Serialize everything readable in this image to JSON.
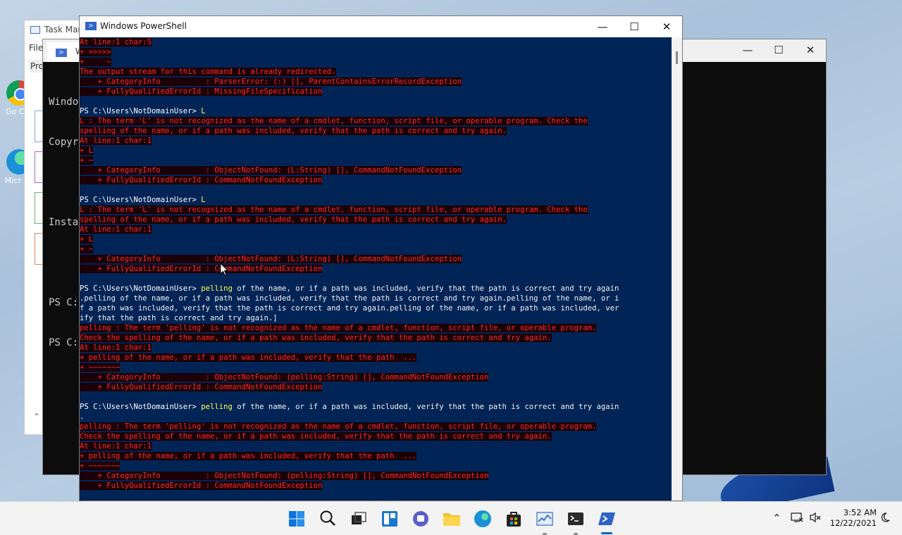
{
  "desktop": {
    "icons": [
      {
        "label": "Go Chr",
        "icon": "chrome-icon"
      },
      {
        "label": "Micr Ed",
        "icon": "edge-icon"
      }
    ]
  },
  "task_manager": {
    "title": "Task Man",
    "file_menu": "File",
    "tab": "Pro"
  },
  "terminal": {
    "tab_label": "W",
    "lines": [
      "Windo",
      "Copyr",
      "",
      "Insta",
      "",
      "PS C:",
      "PS C:"
    ]
  },
  "powershell": {
    "title": "Windows PowerShell",
    "lines": [
      {
        "type": "err",
        "text": "At line:1 char:5"
      },
      {
        "type": "err",
        "text": "+ >>>>>"
      },
      {
        "type": "err",
        "text": "+     ~"
      },
      {
        "type": "err",
        "text": "The output stream for this command is already redirected."
      },
      {
        "type": "err",
        "text": "    + CategoryInfo          : ParserError: (:) [], ParentContainsErrorRecordException"
      },
      {
        "type": "err",
        "text": "    + FullyQualifiedErrorId : MissingFileSpecification"
      },
      {
        "type": "blank",
        "text": ""
      },
      {
        "type": "cmd",
        "prompt": "PS C:\\Users\\NotDomainUser> ",
        "kw": "L",
        "arg": ""
      },
      {
        "type": "err",
        "text": "L : The term 'L' is not recognized as the name of a cmdlet, function, script file, or operable program. Check the"
      },
      {
        "type": "err",
        "text": "spelling of the name, or if a path was included, verify that the path is correct and try again."
      },
      {
        "type": "err",
        "text": "At line:1 char:1"
      },
      {
        "type": "err",
        "text": "+ L"
      },
      {
        "type": "err",
        "text": "+ ~"
      },
      {
        "type": "err",
        "text": "    + CategoryInfo          : ObjectNotFound: (L:String) [], CommandNotFoundException"
      },
      {
        "type": "err",
        "text": "    + FullyQualifiedErrorId : CommandNotFoundException"
      },
      {
        "type": "blank",
        "text": ""
      },
      {
        "type": "cmd",
        "prompt": "PS C:\\Users\\NotDomainUser> ",
        "kw": "L",
        "arg": ""
      },
      {
        "type": "err",
        "text": "L : The term 'L' is not recognized as the name of a cmdlet, function, script file, or operable program. Check the"
      },
      {
        "type": "err",
        "text": "spelling of the name, or if a path was included, verify that the path is correct and try again."
      },
      {
        "type": "err",
        "text": "At line:1 char:1"
      },
      {
        "type": "err",
        "text": "+ L"
      },
      {
        "type": "err",
        "text": "+ ~"
      },
      {
        "type": "err",
        "text": "    + CategoryInfo          : ObjectNotFound: (L:String) [], CommandNotFoundException"
      },
      {
        "type": "err",
        "text": "    + FullyQualifiedErrorId : CommandNotFoundException"
      },
      {
        "type": "blank",
        "text": ""
      },
      {
        "type": "cmd",
        "prompt": "PS C:\\Users\\NotDomainUser> ",
        "kw": "pelling",
        "arg": " of the name, or if a path was included, verify that the path is correct and try again"
      },
      {
        "type": "plain",
        "text": ".pelling of the name, or if a path was included, verify that the path is correct and try again.pelling of the name, or i"
      },
      {
        "type": "plain",
        "text": "f a path was included, verify that the path is correct and try again.pelling of the name, or if a path was included, ver"
      },
      {
        "type": "plain",
        "text": "ify that the path is correct and try again.]"
      },
      {
        "type": "err",
        "text": "pelling : The term 'pelling' is not recognized as the name of a cmdlet, function, script file, or operable program."
      },
      {
        "type": "err",
        "text": "Check the spelling of the name, or if a path was included, verify that the path is correct and try again."
      },
      {
        "type": "err",
        "text": "At line:1 char:1"
      },
      {
        "type": "err",
        "text": "+ pelling of the name, or if a path was included, verify that the path  ..."
      },
      {
        "type": "err",
        "text": "+ ~~~~~~~"
      },
      {
        "type": "err",
        "text": "    + CategoryInfo          : ObjectNotFound: (pelling:String) [], CommandNotFoundException"
      },
      {
        "type": "err",
        "text": "    + FullyQualifiedErrorId : CommandNotFoundException"
      },
      {
        "type": "blank",
        "text": ""
      },
      {
        "type": "cmd",
        "prompt": "PS C:\\Users\\NotDomainUser> ",
        "kw": "pelling",
        "arg": " of the name, or if a path was included, verify that the path is correct and try again"
      },
      {
        "type": "plain",
        "text": "."
      },
      {
        "type": "err",
        "text": "pelling : The term 'pelling' is not recognized as the name of a cmdlet, function, script file, or operable program."
      },
      {
        "type": "err",
        "text": "Check the spelling of the name, or if a path was included, verify that the path is correct and try again."
      },
      {
        "type": "err",
        "text": "At line:1 char:1"
      },
      {
        "type": "err",
        "text": "+ pelling of the name, or if a path was included, verify that the path  ..."
      },
      {
        "type": "err",
        "text": "+ ~~~~~~~"
      },
      {
        "type": "err",
        "text": "    + CategoryInfo          : ObjectNotFound: (pelling:String) [], CommandNotFoundException"
      },
      {
        "type": "err",
        "text": "    + FullyQualifiedErrorId : CommandNotFoundException"
      },
      {
        "type": "blank",
        "text": ""
      }
    ]
  },
  "taskbar": {
    "apps": [
      "start-icon",
      "search-icon",
      "task-view-icon",
      "widgets-icon",
      "chat-icon",
      "file-explorer-icon",
      "edge-icon",
      "store-icon",
      "task-manager-icon",
      "terminal-icon",
      "powershell-icon"
    ],
    "time": "3:52 AM",
    "date": "12/22/2021"
  },
  "colors": {
    "ps_background": "#012456",
    "error_text": "#ff2a2a",
    "command_keyword": "#ffff55",
    "taskbar": "#f3f3f3"
  }
}
